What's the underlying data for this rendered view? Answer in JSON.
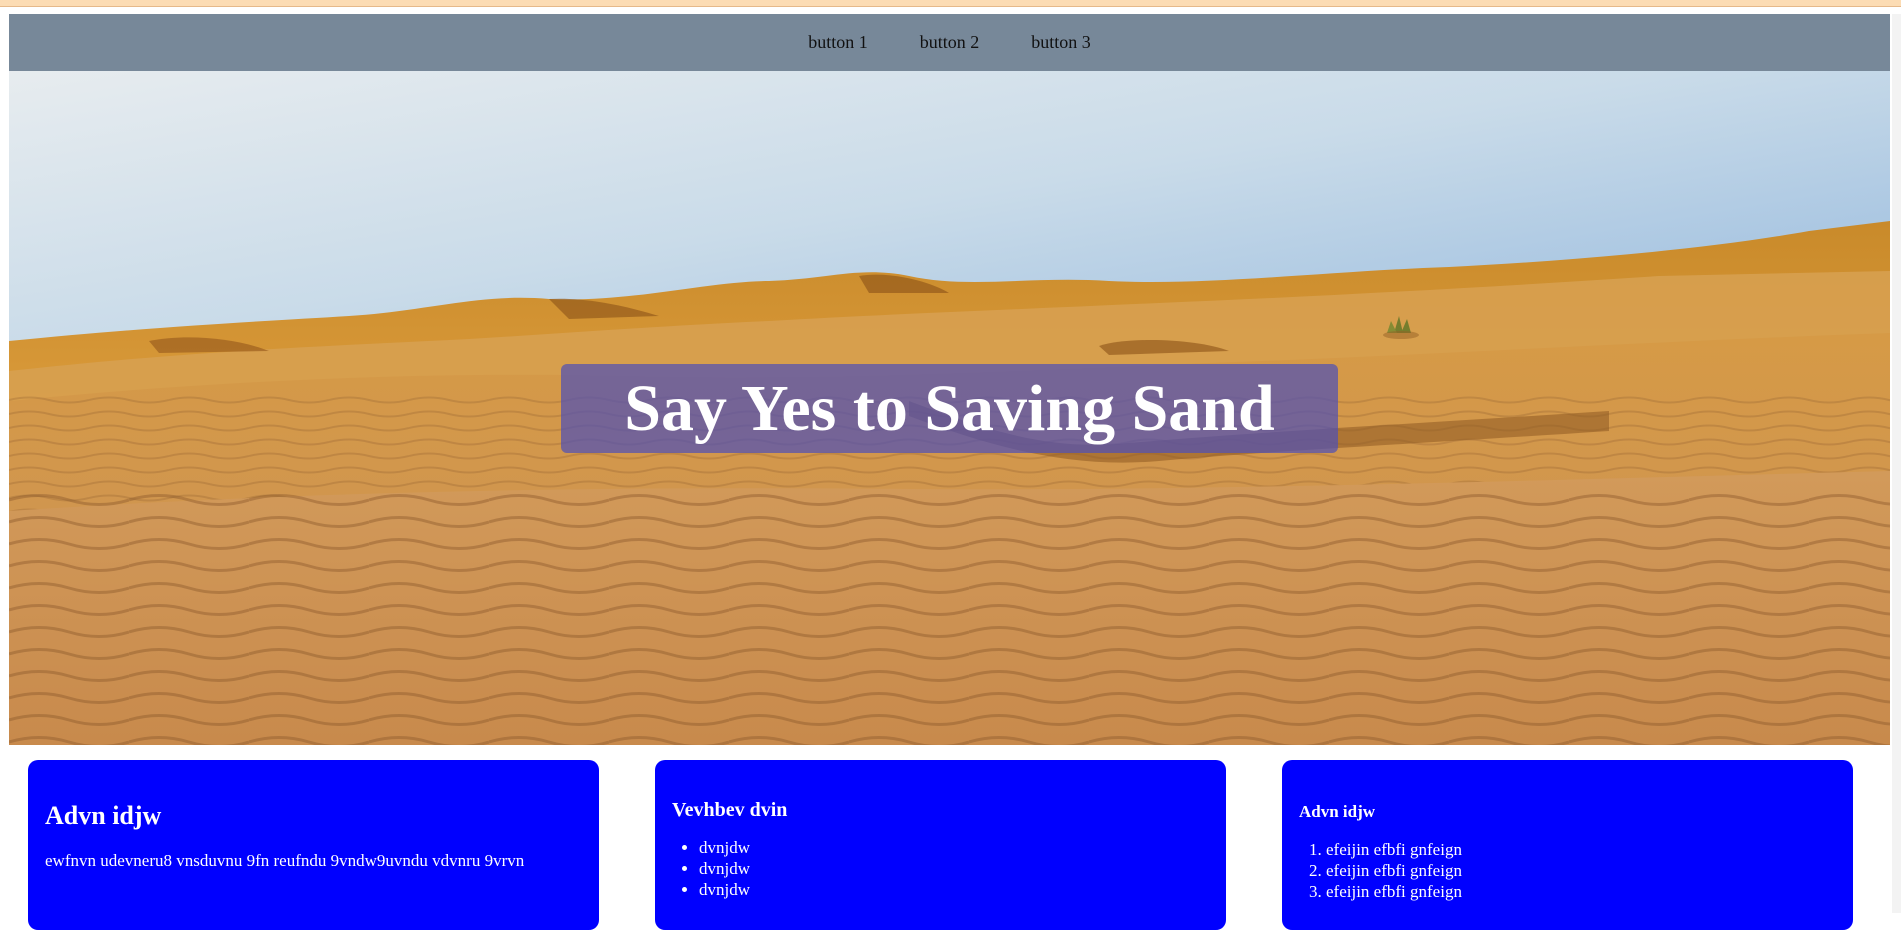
{
  "nav": {
    "buttons": [
      "button 1",
      "button 2",
      "button 3"
    ]
  },
  "hero": {
    "title": "Say Yes to Saving Sand",
    "image": "desert-sand-dunes"
  },
  "cards": [
    {
      "heading": "Advn idjw",
      "text": "ewfnvn udevneru8 vnsduvnu 9fn reufndu 9vndw9uvndu vdvnru 9vrvn"
    },
    {
      "heading": "Vevhbev dvin",
      "items": [
        "dvnjdw",
        "dvnjdw",
        "dvnjdw"
      ]
    },
    {
      "heading": "Advn idjw",
      "items": [
        "efeijin efbfi gnfeign",
        "efeijin efbfi gnfeign",
        "efeijin efbfi gnfeign"
      ]
    }
  ],
  "colors": {
    "navbar": "#778899",
    "card": "#0000ff",
    "title_box": "#5050b4"
  }
}
